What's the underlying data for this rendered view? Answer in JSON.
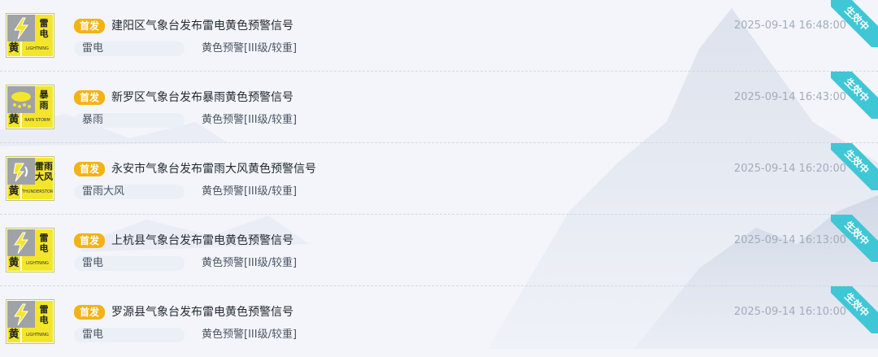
{
  "warnings": [
    {
      "badge": "首发",
      "title": "建阳区气象台发布雷电黄色预警信号",
      "type": "雷电",
      "level": "黄色预警[III级/较重]",
      "time": "2025-09-14 16:48:00",
      "status": "生效中",
      "icon": {
        "name": "lightning-warning-icon",
        "symbol": "bolt",
        "text1": "雷",
        "text2": "电",
        "level_char": "黄",
        "en": "LIGHTNING"
      }
    },
    {
      "badge": "首发",
      "title": "新罗区气象台发布暴雨黄色预警信号",
      "type": "暴雨",
      "level": "黄色预警[III级/较重]",
      "time": "2025-09-14 16:43:00",
      "status": "生效中",
      "icon": {
        "name": "rainstorm-warning-icon",
        "symbol": "rain",
        "text1": "暴",
        "text2": "雨",
        "level_char": "黄",
        "en": "RAIN STORM"
      }
    },
    {
      "badge": "首发",
      "title": "永安市气象台发布雷雨大风黄色预警信号",
      "type": "雷雨大风",
      "level": "黄色预警[III级/较重]",
      "time": "2025-09-14 16:20:00",
      "status": "生效中",
      "icon": {
        "name": "thunderstorm-gale-warning-icon",
        "symbol": "gale",
        "text1": "雷雨",
        "text2": "大风",
        "level_char": "黄",
        "en": "THUNDERSTORM"
      }
    },
    {
      "badge": "首发",
      "title": "上杭县气象台发布雷电黄色预警信号",
      "type": "雷电",
      "level": "黄色预警[III级/较重]",
      "time": "2025-09-14 16:13:00",
      "status": "生效中",
      "icon": {
        "name": "lightning-warning-icon",
        "symbol": "bolt",
        "text1": "雷",
        "text2": "电",
        "level_char": "黄",
        "en": "LIGHTNING"
      }
    },
    {
      "badge": "首发",
      "title": "罗源县气象台发布雷电黄色预警信号",
      "type": "雷电",
      "level": "黄色预警[III级/较重]",
      "time": "2025-09-14 16:10:00",
      "status": "生效中",
      "icon": {
        "name": "lightning-warning-icon",
        "symbol": "bolt",
        "text1": "雷",
        "text2": "电",
        "level_char": "黄",
        "en": "LIGHTNING"
      }
    }
  ],
  "colors": {
    "badge": "#f4b216",
    "status_ribbon": "#3fc7d6",
    "warning_yellow": "#f3e62a",
    "icon_gray": "#9fa3a6"
  }
}
